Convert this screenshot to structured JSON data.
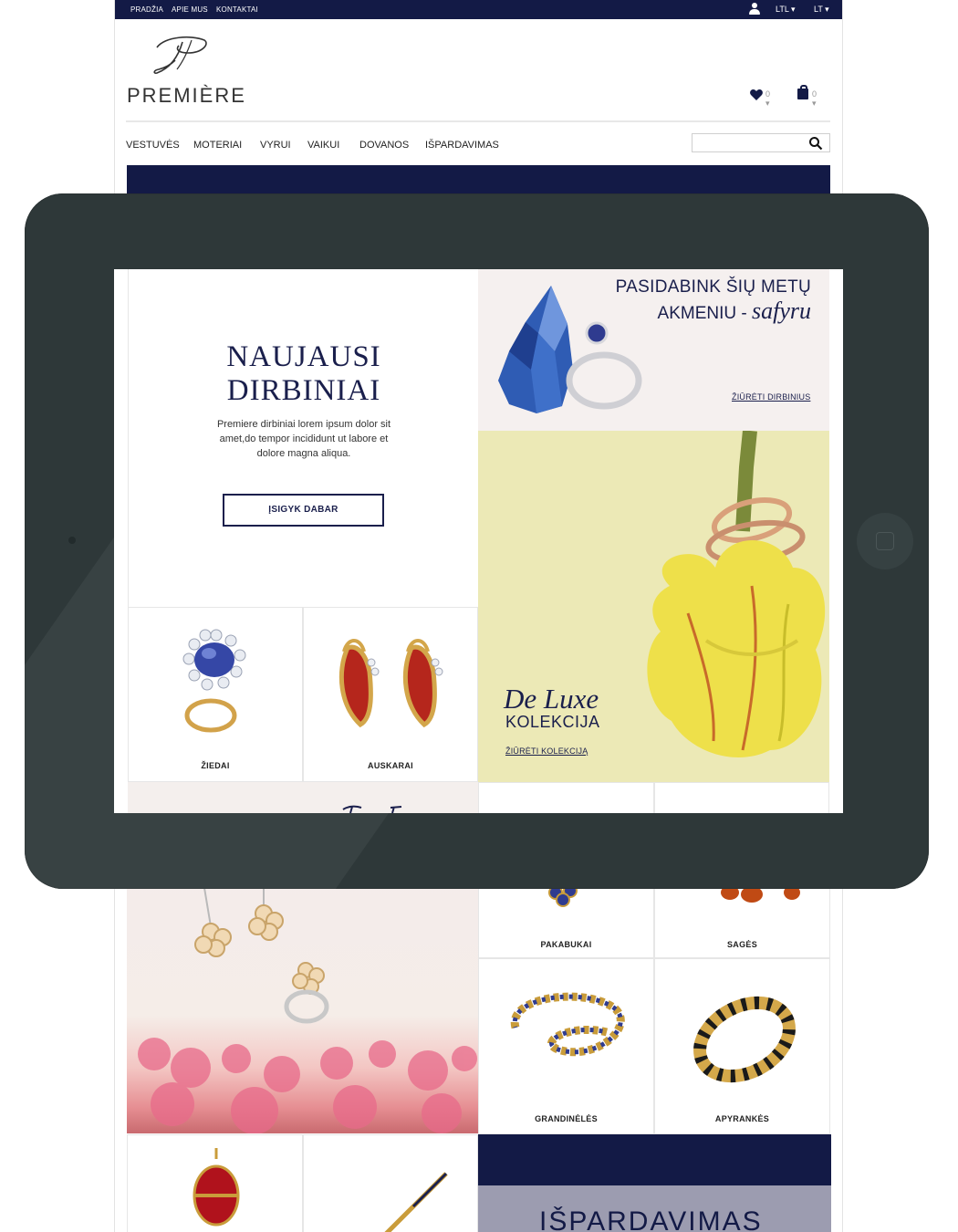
{
  "topbar": {
    "links": [
      "PRADŽIA",
      "APIE MUS",
      "KONTAKTAI"
    ],
    "currency": "LTL ▾",
    "language": "LT ▾"
  },
  "brand": {
    "name": "PREMIÈRE"
  },
  "header": {
    "wishlist_count": "0 ▾",
    "cart_count": "0 ▾"
  },
  "nav": {
    "items": [
      "VESTUVĖS",
      "MOTERIAI",
      "VYRUI",
      "VAIKUI",
      "DOVANOS",
      "IŠPARDAVIMAS"
    ],
    "search_placeholder": ""
  },
  "hero": {
    "title_line1": "NAUJAUSI",
    "title_line2": "DIRBINIAI",
    "text": "Premiere dirbiniai lorem ipsum dolor sit amet,do tempor incididunt ut labore et dolore magna aliqua.",
    "cta": "ĮSIGYK DABAR"
  },
  "sapphire": {
    "line1": "PASIDABINK ŠIŲ METŲ",
    "line2_prefix": "AKMENIU - ",
    "line2_emph": "safyru",
    "link": "ŽIŪRĖTI DIRBINIUS"
  },
  "deluxe": {
    "title": "De Luxe",
    "subtitle": "KOLEKCIJA",
    "link": "ŽIŪRĖTI KOLEKCIJĄ"
  },
  "categories": {
    "rings": "ŽIEDAI",
    "earrings": "AUSKARAI",
    "pendants": "PAKABUKAI",
    "brooches": "SAGĖS",
    "chains": "GRANDINĖLĖS",
    "bracelets": "APYRANKĖS"
  },
  "sale": {
    "label": "IŠPARDAVIMAS"
  },
  "colors": {
    "navy": "#131a46",
    "tablet": "#2e3839",
    "deluxe_bg": "#ece9b6"
  }
}
